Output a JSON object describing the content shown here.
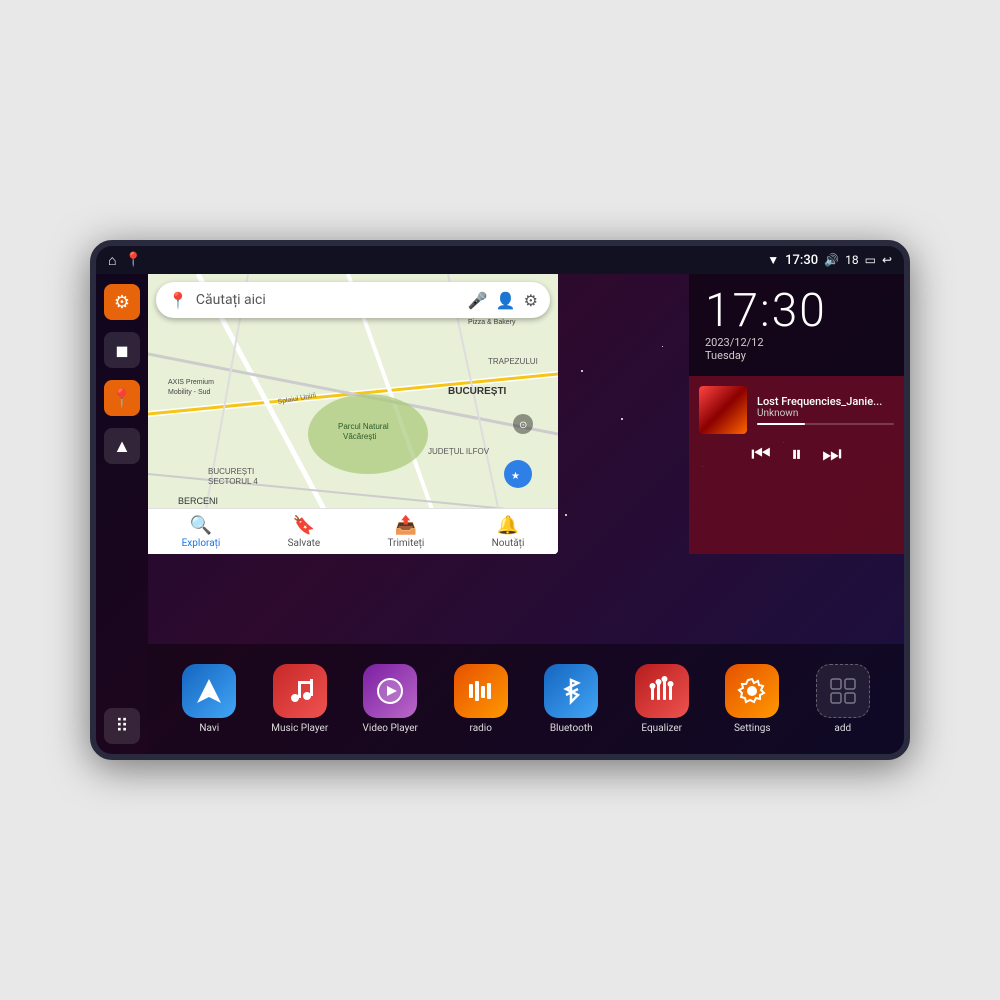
{
  "device": {
    "status_bar": {
      "left_icons": [
        "⌂",
        "📍"
      ],
      "wifi_icon": "▼",
      "time": "17:30",
      "volume_icon": "🔊",
      "battery_level": "18",
      "battery_icon": "🔋",
      "back_icon": "↩"
    },
    "clock": {
      "time": "17:30",
      "date": "2023/12/12",
      "day": "Tuesday"
    },
    "music": {
      "title": "Lost Frequencies_Janie...",
      "artist": "Unknown",
      "progress": 35
    },
    "map": {
      "search_placeholder": "Căutați aici",
      "locations": [
        "AXIS Premium Mobility - Sud",
        "Pizza & Bakery",
        "Parcul Natural Văcărești",
        "BUCUREȘTI",
        "BUCUREȘTI SECTORUL 4",
        "JUDEȚUL ILFOV",
        "BERCENI",
        "TRAPEZULUI"
      ],
      "nav_items": [
        {
          "label": "Explorați",
          "icon": "📍"
        },
        {
          "label": "Salvate",
          "icon": "🔖"
        },
        {
          "label": "Trimiteți",
          "icon": "📤"
        },
        {
          "label": "Noutăți",
          "icon": "🔔"
        }
      ]
    },
    "sidebar": {
      "items": [
        {
          "icon": "⚙",
          "type": "orange"
        },
        {
          "icon": "◼",
          "type": "dark"
        },
        {
          "icon": "📍",
          "type": "orange"
        },
        {
          "icon": "▲",
          "type": "dark"
        }
      ],
      "bottom": {
        "icon": "⠿"
      }
    },
    "apps": [
      {
        "id": "navi",
        "label": "Navi",
        "icon_class": "icon-navi",
        "icon": "▲"
      },
      {
        "id": "music-player",
        "label": "Music Player",
        "icon_class": "icon-music",
        "icon": "♪"
      },
      {
        "id": "video-player",
        "label": "Video Player",
        "icon_class": "icon-video",
        "icon": "▶"
      },
      {
        "id": "radio",
        "label": "radio",
        "icon_class": "icon-radio",
        "icon": "📶"
      },
      {
        "id": "bluetooth",
        "label": "Bluetooth",
        "icon_class": "icon-bluetooth",
        "icon": "⚡"
      },
      {
        "id": "equalizer",
        "label": "Equalizer",
        "icon_class": "icon-equalizer",
        "icon": "▊"
      },
      {
        "id": "settings",
        "label": "Settings",
        "icon_class": "icon-settings",
        "icon": "⚙"
      },
      {
        "id": "add",
        "label": "add",
        "icon_class": "icon-add",
        "icon": "✦"
      }
    ]
  }
}
